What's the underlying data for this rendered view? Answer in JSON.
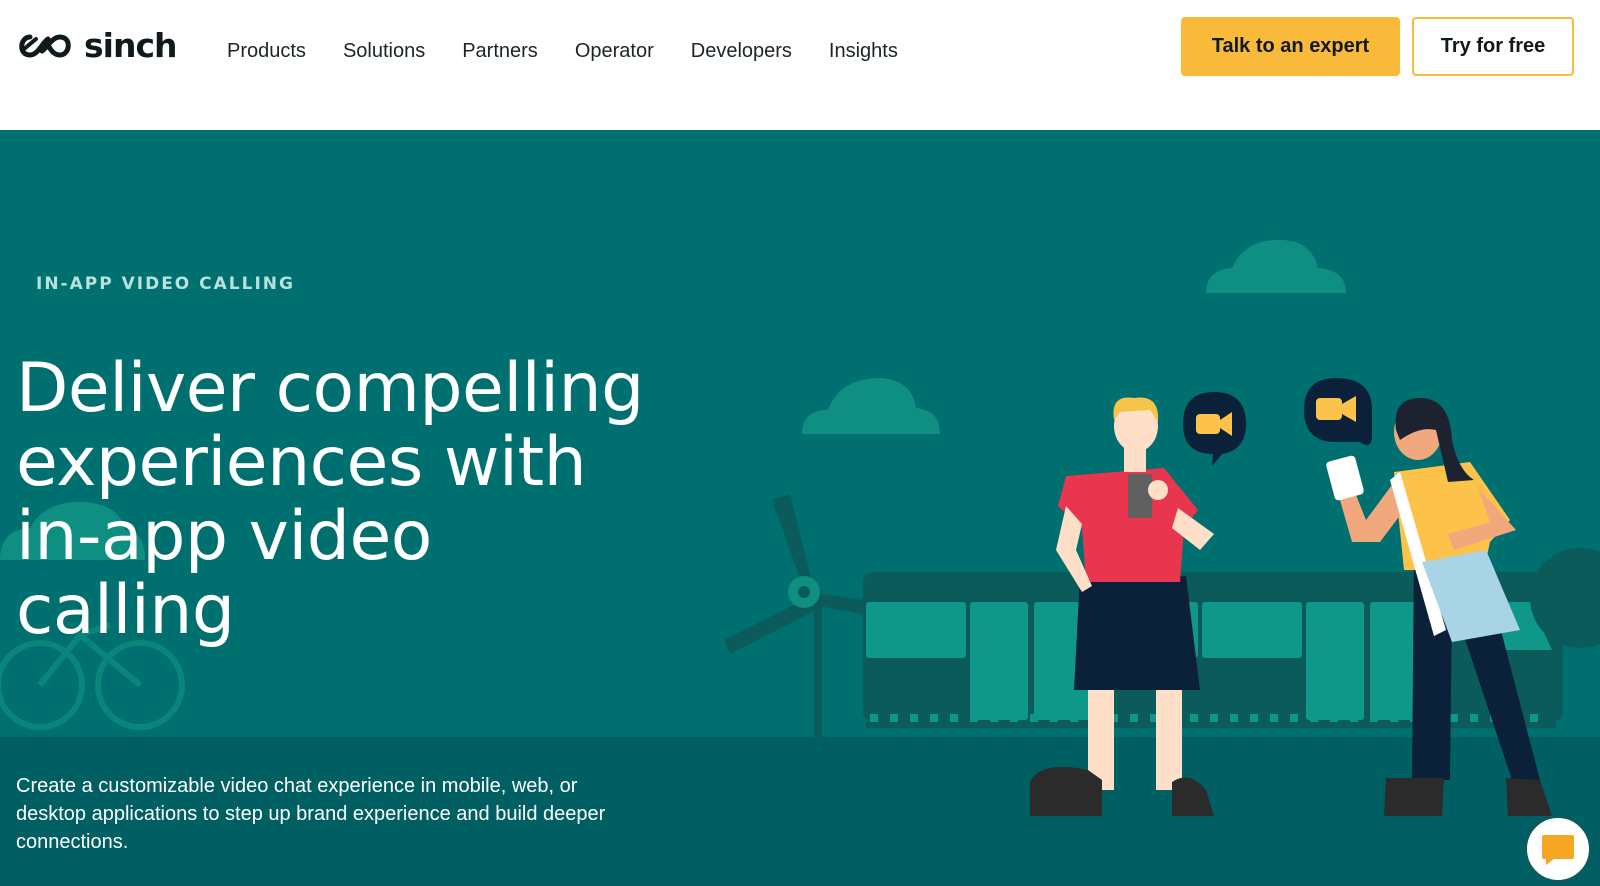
{
  "brand": {
    "name": "sinch"
  },
  "nav": {
    "items": [
      {
        "label": "Products"
      },
      {
        "label": "Solutions"
      },
      {
        "label": "Partners"
      },
      {
        "label": "Operator"
      },
      {
        "label": "Developers"
      },
      {
        "label": "Insights"
      }
    ]
  },
  "header": {
    "cta_primary": "Talk to an expert",
    "cta_secondary": "Try for free"
  },
  "hero": {
    "eyebrow": "IN-APP VIDEO CALLING",
    "headline": "Deliver compelling experiences with in-app video calling",
    "subtext": "Create a customizable video chat experience in mobile, web, or desktop applications to step up brand experience and build deeper connections."
  },
  "colors": {
    "accent": "#f9ba3b",
    "hero_bg": "#006f6f",
    "ground": "#005f62",
    "text_dark": "#1b2526"
  },
  "icons": {
    "logo": "sinch-infinity-icon",
    "chat": "chat-bubble-icon",
    "video": "video-camera-icon"
  }
}
